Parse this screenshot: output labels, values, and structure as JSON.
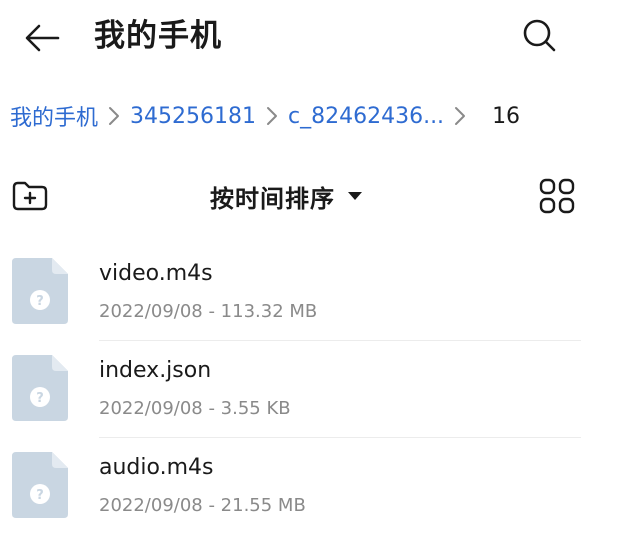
{
  "header": {
    "title": "我的手机",
    "back_icon": "back-arrow-icon",
    "search_icon": "search-icon"
  },
  "breadcrumb": {
    "items": [
      {
        "label": "我的手机"
      },
      {
        "label": "345256181"
      },
      {
        "label": "c_82462436..."
      },
      {
        "label": "16"
      }
    ],
    "separator_icon": "chevron-right-icon"
  },
  "toolbar": {
    "sort_label": "按时间排序",
    "new_folder_icon": "new-folder-icon",
    "sort_caret_icon": "caret-down-icon",
    "grid_icon": "grid-view-icon"
  },
  "files": [
    {
      "name": "video.m4s",
      "meta": "2022/09/08 - 113.32 MB",
      "icon": "unknown-file-icon"
    },
    {
      "name": "index.json",
      "meta": "2022/09/08 - 3.55 KB",
      "icon": "unknown-file-icon"
    },
    {
      "name": "audio.m4s",
      "meta": "2022/09/08 - 21.55 MB",
      "icon": "unknown-file-icon"
    }
  ],
  "colors": {
    "link": "#2e6bd1",
    "text": "#1a1a1a",
    "meta": "#8a8a8a",
    "file_icon_body": "#c9d6e2",
    "file_icon_fold": "#e3eaf1"
  }
}
